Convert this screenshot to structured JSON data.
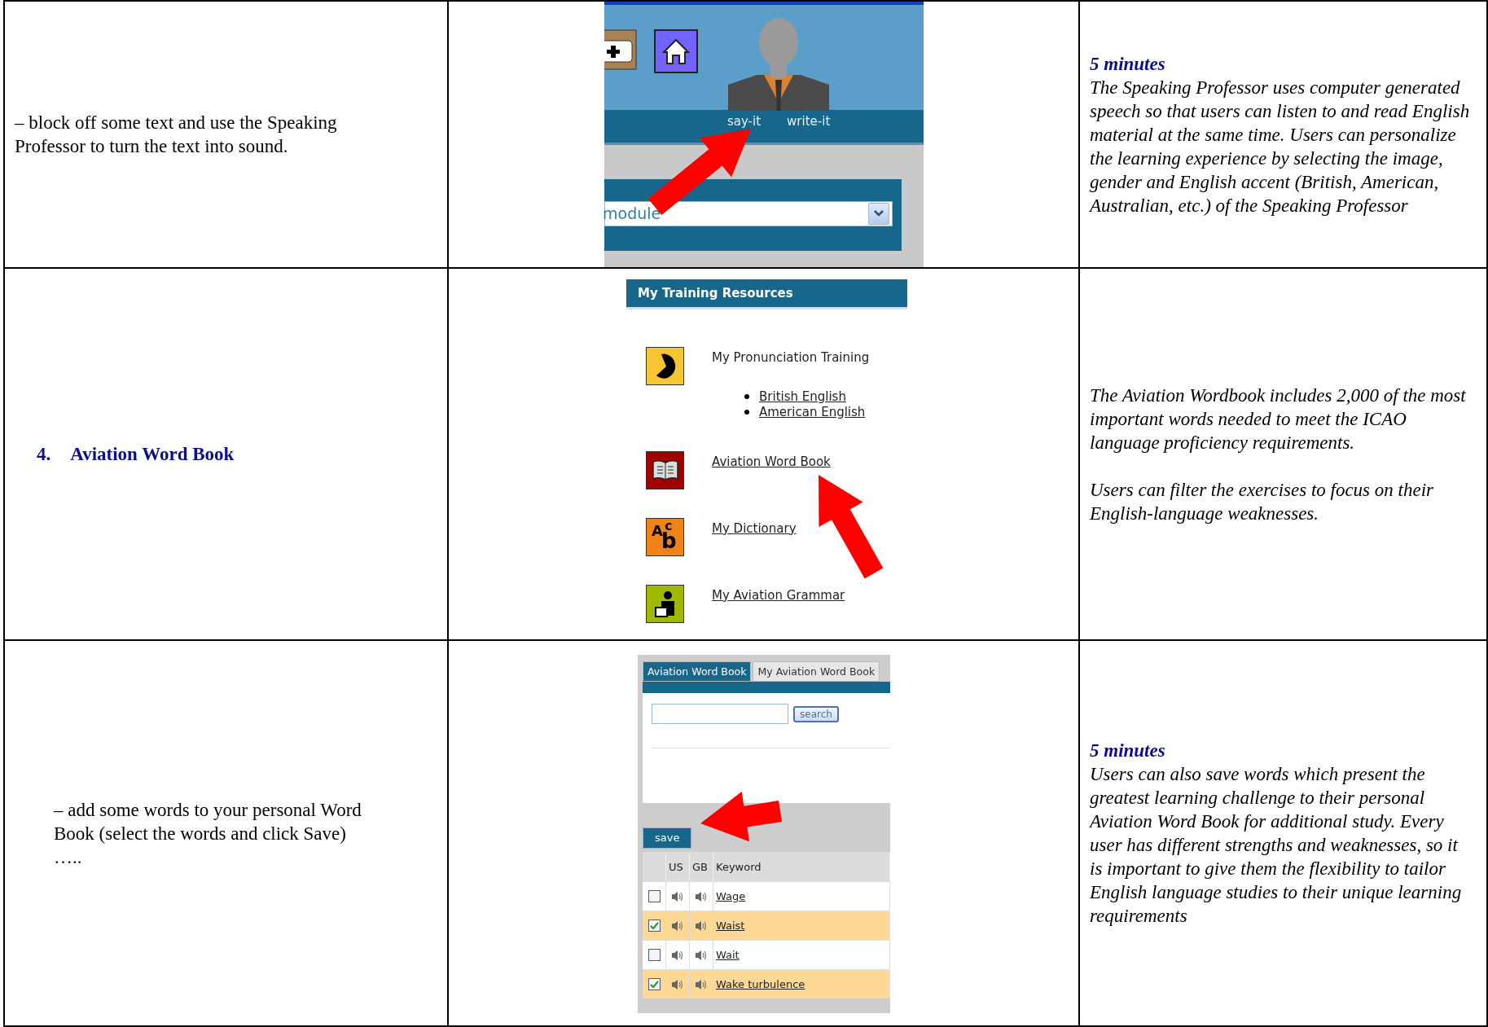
{
  "rows": [
    {
      "left": {
        "kind": "note",
        "text": "– block off some text and use the Speaking Professor to turn the text into sound."
      },
      "middle": {
        "kind": "professor",
        "bar_links": [
          "say-it",
          "write-it"
        ],
        "select_value": "module"
      },
      "right": {
        "duration": "5 minutes",
        "paragraphs": [
          "The Speaking Professor uses computer generated speech so that users can listen to and read English material at the same time. Users can personalize the learning experience by selecting the image, gender and English accent (British, American, Australian, etc.) of the Speaking Professor"
        ]
      }
    },
    {
      "left": {
        "kind": "heading",
        "number": "4.",
        "title": "Aviation Word Book"
      },
      "middle": {
        "kind": "resources",
        "title": "My Training Resources",
        "items": [
          {
            "kind": "pronunciation",
            "label": "My Pronunciation Training",
            "link": false,
            "children": [
              "British English",
              "American English"
            ]
          },
          {
            "kind": "wordbook",
            "label": "Aviation Word Book",
            "link": true
          },
          {
            "kind": "dictionary",
            "label": "My Dictionary",
            "link": true,
            "icon_glyphs": [
              "A",
              "c",
              "b"
            ]
          },
          {
            "kind": "grammar",
            "label": "My Aviation Grammar",
            "link": true
          }
        ]
      },
      "right": {
        "paragraphs": [
          "The Aviation Wordbook includes 2,000 of the most important words needed to meet the ICAO language proficiency requirements.",
          "Users can filter the exercises to focus on their English-language weaknesses."
        ]
      }
    },
    {
      "left": {
        "kind": "indented_note",
        "text": "–  add some words to your personal Word Book (select the words and click Save) ….."
      },
      "middle": {
        "kind": "wordbook",
        "tabs": [
          {
            "label": "Aviation Word Book",
            "selected": true
          },
          {
            "label": "My Aviation Word Book",
            "selected": false
          }
        ],
        "search_button": "search",
        "save_button": "save",
        "columns": [
          "US",
          "GB",
          "Keyword"
        ],
        "words": [
          {
            "word": "Wage",
            "checked": false
          },
          {
            "word": "Waist",
            "checked": true
          },
          {
            "word": "Wait",
            "checked": false
          },
          {
            "word": "Wake turbulence",
            "checked": true
          }
        ]
      },
      "right": {
        "duration": "5 minutes",
        "paragraphs": [
          "Users can also save words which present the greatest learning challenge to their personal Aviation Word Book for additional study. Every user has different strengths and weaknesses, so it is important to give them the flexibility to tailor English language studies to their unique learning requirements"
        ]
      }
    }
  ]
}
